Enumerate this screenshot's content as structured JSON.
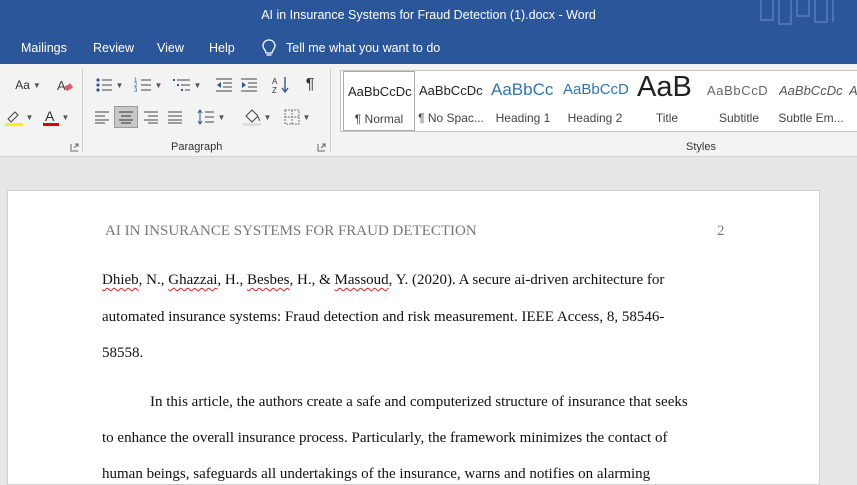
{
  "window": {
    "title": "AI in Insurance Systems for Fraud Detection (1).docx  -  Word"
  },
  "menu": {
    "items": [
      "Mailings",
      "Review",
      "View",
      "Help"
    ],
    "tell_me": "Tell me what you want to do"
  },
  "ribbon": {
    "paragraph_label": "Paragraph",
    "styles_label": "Styles",
    "font_case": "Aa",
    "styles": [
      {
        "preview": "AaBbCcDc",
        "name": "¶ Normal"
      },
      {
        "preview": "AaBbCcDc",
        "name": "¶ No Spac..."
      },
      {
        "preview": "AaBbCc",
        "name": "Heading 1"
      },
      {
        "preview": "AaBbCcD",
        "name": "Heading 2"
      },
      {
        "preview": "AaB",
        "name": "Title"
      },
      {
        "preview": "AaBbCcD",
        "name": "Subtitle"
      },
      {
        "preview": "AaBbCcDc",
        "name": "Subtle Em..."
      },
      {
        "preview": "A",
        "name": ""
      }
    ]
  },
  "document": {
    "header": "AI IN INSURANCE SYSTEMS FOR FRAUD DETECTION",
    "page_number": "2",
    "ref": {
      "a1": "Dhieb",
      "a2": ", N., ",
      "a3": "Ghazzai",
      "a4": ", H., ",
      "a5": "Besbes",
      "a6": ", H., & ",
      "a7": "Massoud",
      "a8": ", Y. (2020). A secure ai-driven architecture for",
      "line2": "automated insurance systems: Fraud detection and risk measurement. IEEE Access, 8, 58546-",
      "line3": "58558."
    },
    "para": [
      "In this article, the authors create a safe and computerized structure of insurance that seeks",
      "to enhance the overall insurance process. Particularly, the framework minimizes the contact of",
      "human beings, safeguards all undertakings of the insurance, warns and notifies on alarming"
    ]
  }
}
